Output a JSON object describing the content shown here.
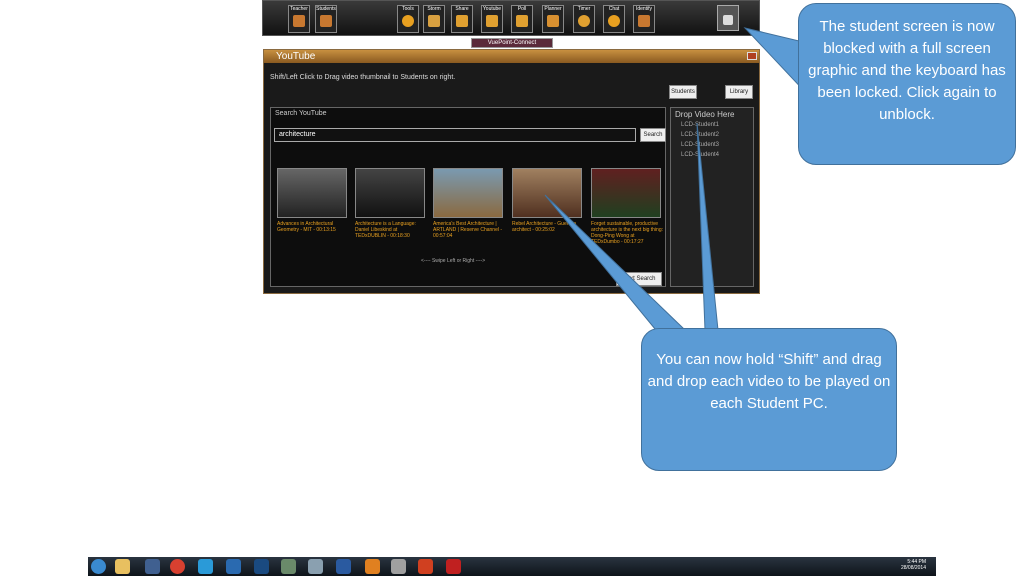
{
  "toolbar": {
    "buttons": [
      {
        "label": "Teacher",
        "icon": "teacher-icon"
      },
      {
        "label": "Students",
        "icon": "students-icon"
      },
      {
        "label": "Tools",
        "icon": "gear-icon"
      },
      {
        "label": "Storm",
        "icon": "storm-icon"
      },
      {
        "label": "Share",
        "icon": "share-icon"
      },
      {
        "label": "Youtube",
        "icon": "youtube-icon"
      },
      {
        "label": "Poll",
        "icon": "poll-icon"
      },
      {
        "label": "Planner",
        "icon": "planner-icon"
      },
      {
        "label": "Timer",
        "icon": "timer-icon"
      },
      {
        "label": "Chat",
        "icon": "chat-icon"
      },
      {
        "label": "Identify",
        "icon": "identify-icon"
      }
    ],
    "tab_label": "VuePoint-Connect"
  },
  "youtube_window": {
    "title": "YouTube",
    "instruction": "Shift/Left Click to Drag video thumbnail to Students on right.",
    "students_button": "Students",
    "library_button": "Library",
    "search_label": "Search YouTube",
    "search_value": "architecture",
    "search_button": "Search",
    "videos": [
      {
        "title": "Advances in Architectural Geometry - MIT - 00:13:15"
      },
      {
        "title": "Architecture is a Language: Daniel Libeskind at TEDxDUBLIN - 00:18:30"
      },
      {
        "title": "America's Best Architecture | ARTLAND | Reserve Channel - 00:57:04"
      },
      {
        "title": "Rebel Architecture - Guerrilla architect - 00:25:02"
      },
      {
        "title": "Forget sustainable, productive architecture is the next big thing: Dong-Ping Wong at TEDxDumbo - 00:17:27"
      }
    ],
    "swipe_hint": "<---- Swipe Left or Right ---->",
    "next_search_button": "Next Search",
    "drop_title": "Drop Video Here",
    "students": [
      "LCD-Student1",
      "LCD-Student2",
      "LCD-Student3",
      "LCD-Student4"
    ]
  },
  "callouts": {
    "blocked": "The student screen is now blocked with a full screen graphic and the keyboard has been locked. Click again to unblock.",
    "shift_drag": "You can now hold “Shift” and drag and drop each video to be played on each Student PC."
  },
  "taskbar": {
    "apps": [
      "windows-start-icon",
      "file-explorer-icon",
      "media-player-icon",
      "chrome-icon",
      "skype-icon",
      "outlook-icon",
      "photoshop-icon",
      "app-icon",
      "app-icon",
      "word-icon",
      "blender-icon",
      "app-icon",
      "powerpoint-icon",
      "acrobat-icon"
    ],
    "time": "5:44 PM",
    "date": "28/08/2014"
  },
  "colors": {
    "callout_fill": "#5b9bd5",
    "video_title": "#e8a020"
  }
}
